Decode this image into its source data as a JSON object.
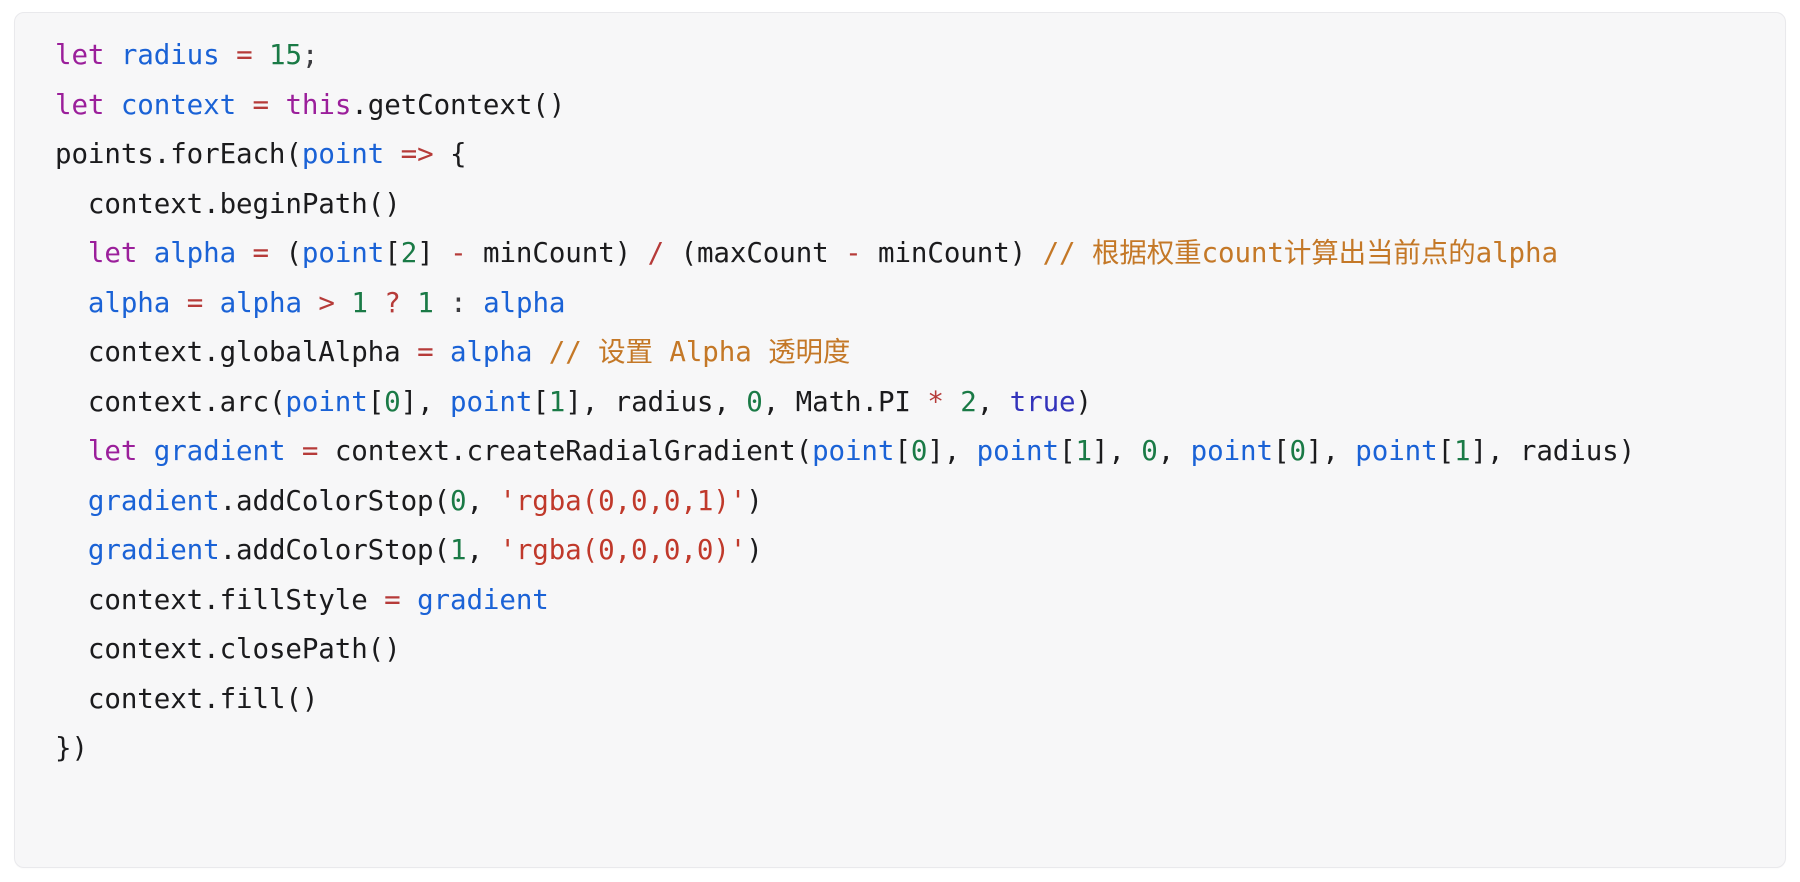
{
  "card": {
    "background": "#f7f7f8",
    "border_color": "#e9e9ec",
    "language": "javascript"
  },
  "theme": {
    "keyword": "#9b1f9b",
    "variable": "#1a62d6",
    "number": "#1a7a46",
    "operator": "#b63b39",
    "comment": "#c47827",
    "string": "#c0392b",
    "constant": "#3333bb",
    "plain": "#1b1b1d",
    "punctuation": "#3c3c40"
  },
  "code": {
    "full_text": "let radius = 15;\nlet context = this.getContext()\npoints.forEach(point => {\n  context.beginPath()\n  let alpha = (point[2] - minCount) / (maxCount - minCount) // 根据权重count计算出当前点的alpha\n  alpha = alpha > 1 ? 1 : alpha\n  context.globalAlpha = alpha // 设置 Alpha 透明度\n  context.arc(point[0], point[1], radius, 0, Math.PI * 2, true)\n  let gradient = context.createRadialGradient(point[0], point[1], 0, point[0], point[1], radius)\n  gradient.addColorStop(0, 'rgba(0,0,0,1)')\n  gradient.addColorStop(1, 'rgba(0,0,0,0)')\n  context.fillStyle = gradient\n  context.closePath()\n  context.fill()\n})",
    "lines": [
      {
        "index": 1,
        "text": "let radius = 15;",
        "tokens": [
          {
            "t": "let",
            "c": "keyword"
          },
          {
            "t": " ",
            "c": "plain"
          },
          {
            "t": "radius",
            "c": "variable"
          },
          {
            "t": " ",
            "c": "plain"
          },
          {
            "t": "=",
            "c": "operator"
          },
          {
            "t": " ",
            "c": "plain"
          },
          {
            "t": "15",
            "c": "number"
          },
          {
            "t": ";",
            "c": "punct"
          }
        ]
      },
      {
        "index": 2,
        "text": "let context = this.getContext()",
        "tokens": [
          {
            "t": "let",
            "c": "keyword"
          },
          {
            "t": " ",
            "c": "plain"
          },
          {
            "t": "context",
            "c": "variable"
          },
          {
            "t": " ",
            "c": "plain"
          },
          {
            "t": "=",
            "c": "operator"
          },
          {
            "t": " ",
            "c": "plain"
          },
          {
            "t": "this",
            "c": "keyword"
          },
          {
            "t": ".getContext()",
            "c": "plain"
          }
        ]
      },
      {
        "index": 3,
        "text": "points.forEach(point => {",
        "tokens": [
          {
            "t": "points.forEach(",
            "c": "plain"
          },
          {
            "t": "point",
            "c": "variable"
          },
          {
            "t": " ",
            "c": "plain"
          },
          {
            "t": "=>",
            "c": "operator"
          },
          {
            "t": " {",
            "c": "plain"
          }
        ]
      },
      {
        "index": 4,
        "text": "  context.beginPath()",
        "tokens": [
          {
            "t": "  context.beginPath()",
            "c": "plain"
          }
        ]
      },
      {
        "index": 5,
        "text": "  let alpha = (point[2] - minCount) / (maxCount - minCount) // 根据权重count计算出当前点的alpha",
        "tokens": [
          {
            "t": "  ",
            "c": "plain"
          },
          {
            "t": "let",
            "c": "keyword"
          },
          {
            "t": " ",
            "c": "plain"
          },
          {
            "t": "alpha",
            "c": "variable"
          },
          {
            "t": " ",
            "c": "plain"
          },
          {
            "t": "=",
            "c": "operator"
          },
          {
            "t": " (",
            "c": "plain"
          },
          {
            "t": "point",
            "c": "variable"
          },
          {
            "t": "[",
            "c": "plain"
          },
          {
            "t": "2",
            "c": "number"
          },
          {
            "t": "] ",
            "c": "plain"
          },
          {
            "t": "-",
            "c": "operator"
          },
          {
            "t": " minCount) ",
            "c": "plain"
          },
          {
            "t": "/",
            "c": "operator"
          },
          {
            "t": " (maxCount ",
            "c": "plain"
          },
          {
            "t": "-",
            "c": "operator"
          },
          {
            "t": " minCount) ",
            "c": "plain"
          },
          {
            "t": "// 根据权重count计算出当前点的alpha",
            "c": "comment"
          }
        ]
      },
      {
        "index": 6,
        "text": "  alpha = alpha > 1 ? 1 : alpha",
        "tokens": [
          {
            "t": "  ",
            "c": "plain"
          },
          {
            "t": "alpha",
            "c": "variable"
          },
          {
            "t": " ",
            "c": "plain"
          },
          {
            "t": "=",
            "c": "operator"
          },
          {
            "t": " ",
            "c": "plain"
          },
          {
            "t": "alpha",
            "c": "variable"
          },
          {
            "t": " ",
            "c": "plain"
          },
          {
            "t": ">",
            "c": "operator"
          },
          {
            "t": " ",
            "c": "plain"
          },
          {
            "t": "1",
            "c": "number"
          },
          {
            "t": " ",
            "c": "plain"
          },
          {
            "t": "?",
            "c": "operator"
          },
          {
            "t": " ",
            "c": "plain"
          },
          {
            "t": "1",
            "c": "number"
          },
          {
            "t": " ",
            "c": "plain"
          },
          {
            "t": ":",
            "c": "punct"
          },
          {
            "t": " ",
            "c": "plain"
          },
          {
            "t": "alpha",
            "c": "variable"
          }
        ]
      },
      {
        "index": 7,
        "text": "  context.globalAlpha = alpha // 设置 Alpha 透明度",
        "tokens": [
          {
            "t": "  context.globalAlpha ",
            "c": "plain"
          },
          {
            "t": "=",
            "c": "operator"
          },
          {
            "t": " ",
            "c": "plain"
          },
          {
            "t": "alpha",
            "c": "variable"
          },
          {
            "t": " ",
            "c": "plain"
          },
          {
            "t": "// 设置 Alpha 透明度",
            "c": "comment"
          }
        ]
      },
      {
        "index": 8,
        "text": "  context.arc(point[0], point[1], radius, 0, Math.PI * 2, true)",
        "tokens": [
          {
            "t": "  context.arc(",
            "c": "plain"
          },
          {
            "t": "point",
            "c": "variable"
          },
          {
            "t": "[",
            "c": "plain"
          },
          {
            "t": "0",
            "c": "number"
          },
          {
            "t": "], ",
            "c": "plain"
          },
          {
            "t": "point",
            "c": "variable"
          },
          {
            "t": "[",
            "c": "plain"
          },
          {
            "t": "1",
            "c": "number"
          },
          {
            "t": "], radius, ",
            "c": "plain"
          },
          {
            "t": "0",
            "c": "number"
          },
          {
            "t": ", Math.PI ",
            "c": "plain"
          },
          {
            "t": "*",
            "c": "operator"
          },
          {
            "t": " ",
            "c": "plain"
          },
          {
            "t": "2",
            "c": "number"
          },
          {
            "t": ", ",
            "c": "plain"
          },
          {
            "t": "true",
            "c": "constant"
          },
          {
            "t": ")",
            "c": "plain"
          }
        ]
      },
      {
        "index": 9,
        "text": "  let gradient = context.createRadialGradient(point[0], point[1], 0, point[0], point[1], radius)",
        "tokens": [
          {
            "t": "  ",
            "c": "plain"
          },
          {
            "t": "let",
            "c": "keyword"
          },
          {
            "t": " ",
            "c": "plain"
          },
          {
            "t": "gradient",
            "c": "variable"
          },
          {
            "t": " ",
            "c": "plain"
          },
          {
            "t": "=",
            "c": "operator"
          },
          {
            "t": " context.createRadialGradient(",
            "c": "plain"
          },
          {
            "t": "point",
            "c": "variable"
          },
          {
            "t": "[",
            "c": "plain"
          },
          {
            "t": "0",
            "c": "number"
          },
          {
            "t": "], ",
            "c": "plain"
          },
          {
            "t": "point",
            "c": "variable"
          },
          {
            "t": "[",
            "c": "plain"
          },
          {
            "t": "1",
            "c": "number"
          },
          {
            "t": "], ",
            "c": "plain"
          },
          {
            "t": "0",
            "c": "number"
          },
          {
            "t": ", ",
            "c": "plain"
          },
          {
            "t": "point",
            "c": "variable"
          },
          {
            "t": "[",
            "c": "plain"
          },
          {
            "t": "0",
            "c": "number"
          },
          {
            "t": "], ",
            "c": "plain"
          },
          {
            "t": "point",
            "c": "variable"
          },
          {
            "t": "[",
            "c": "plain"
          },
          {
            "t": "1",
            "c": "number"
          },
          {
            "t": "], radius)",
            "c": "plain"
          }
        ]
      },
      {
        "index": 10,
        "text": "  gradient.addColorStop(0, 'rgba(0,0,0,1)')",
        "tokens": [
          {
            "t": "  ",
            "c": "plain"
          },
          {
            "t": "gradient",
            "c": "variable"
          },
          {
            "t": ".addColorStop(",
            "c": "plain"
          },
          {
            "t": "0",
            "c": "number"
          },
          {
            "t": ", ",
            "c": "plain"
          },
          {
            "t": "'rgba(0,0,0,1)'",
            "c": "string"
          },
          {
            "t": ")",
            "c": "plain"
          }
        ]
      },
      {
        "index": 11,
        "text": "  gradient.addColorStop(1, 'rgba(0,0,0,0)')",
        "tokens": [
          {
            "t": "  ",
            "c": "plain"
          },
          {
            "t": "gradient",
            "c": "variable"
          },
          {
            "t": ".addColorStop(",
            "c": "plain"
          },
          {
            "t": "1",
            "c": "number"
          },
          {
            "t": ", ",
            "c": "plain"
          },
          {
            "t": "'rgba(0,0,0,0)'",
            "c": "string"
          },
          {
            "t": ")",
            "c": "plain"
          }
        ]
      },
      {
        "index": 12,
        "text": "  context.fillStyle = gradient",
        "tokens": [
          {
            "t": "  context.fillStyle ",
            "c": "plain"
          },
          {
            "t": "=",
            "c": "operator"
          },
          {
            "t": " ",
            "c": "plain"
          },
          {
            "t": "gradient",
            "c": "variable"
          }
        ]
      },
      {
        "index": 13,
        "text": "  context.closePath()",
        "tokens": [
          {
            "t": "  context.closePath()",
            "c": "plain"
          }
        ]
      },
      {
        "index": 14,
        "text": "  context.fill()",
        "tokens": [
          {
            "t": "  context.fill()",
            "c": "plain"
          }
        ]
      },
      {
        "index": 15,
        "text": "})",
        "tokens": [
          {
            "t": "})",
            "c": "plain"
          }
        ]
      }
    ]
  }
}
